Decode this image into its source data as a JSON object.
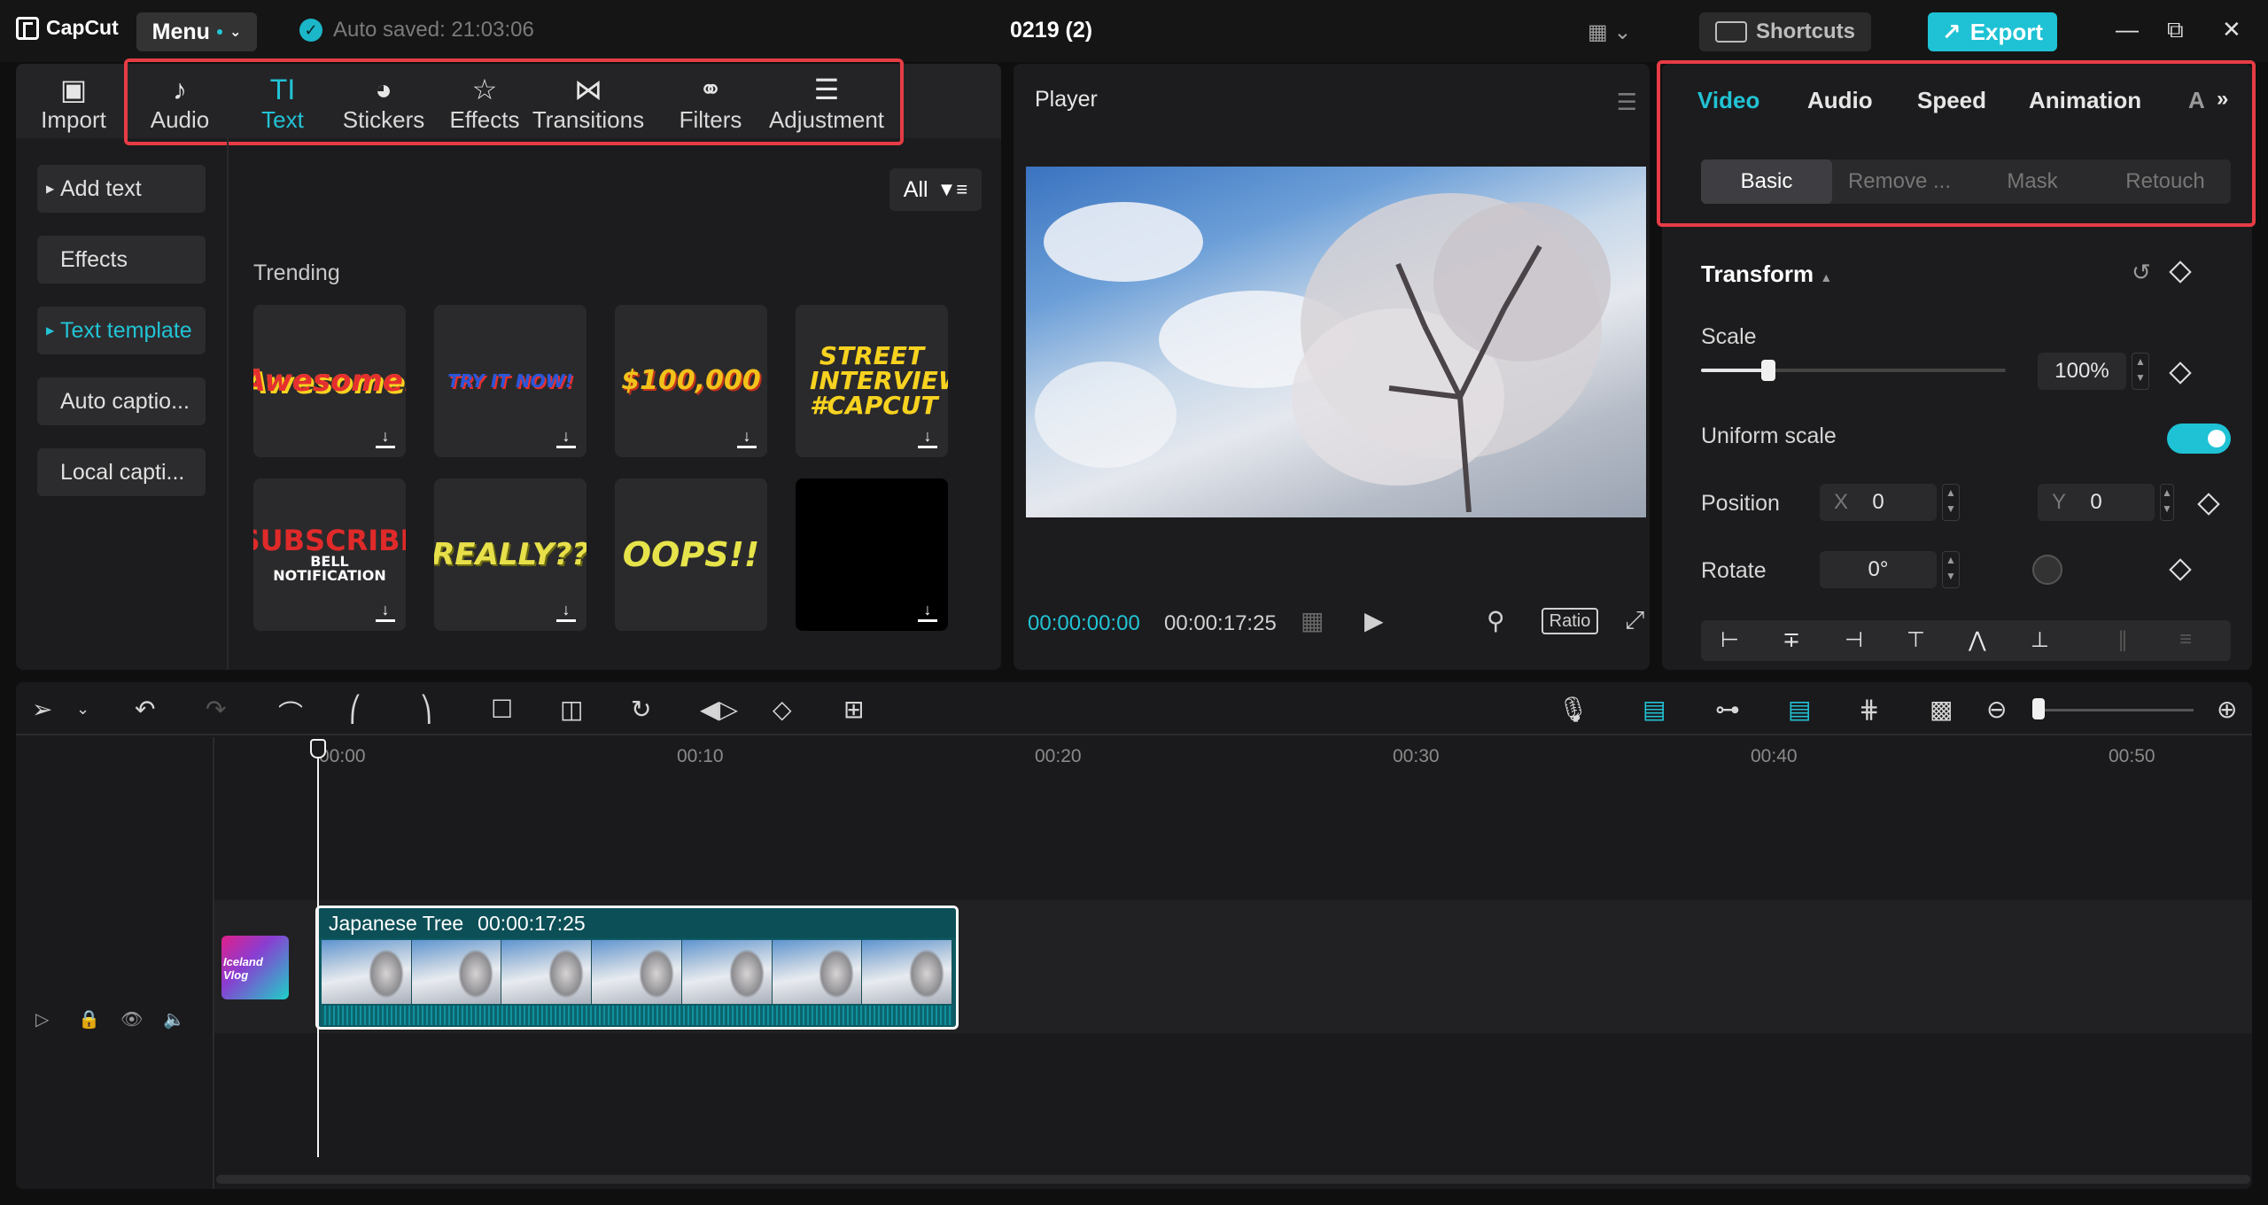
{
  "app": {
    "brand": "CapCut",
    "menu_label": "Menu",
    "autosave": "Auto saved: 21:03:06",
    "project_title": "0219 (2)",
    "shortcuts_label": "Shortcuts",
    "export_label": "Export"
  },
  "media_tools": [
    {
      "label": "Import",
      "icon": "import-icon"
    },
    {
      "label": "Audio",
      "icon": "audio-icon"
    },
    {
      "label": "Text",
      "icon": "text-icon",
      "active": true
    },
    {
      "label": "Stickers",
      "icon": "stickers-icon"
    },
    {
      "label": "Effects",
      "icon": "effects-icon"
    },
    {
      "label": "Transitions",
      "icon": "transitions-icon"
    },
    {
      "label": "Filters",
      "icon": "filters-icon"
    },
    {
      "label": "Adjustment",
      "icon": "adjustment-icon"
    }
  ],
  "text_nav": [
    {
      "label": "Add text"
    },
    {
      "label": "Effects"
    },
    {
      "label": "Text template",
      "active": true
    },
    {
      "label": "Auto captio..."
    },
    {
      "label": "Local capti..."
    }
  ],
  "library": {
    "filter_label": "All",
    "section_title": "Trending",
    "templates": [
      {
        "text": "Awesome!",
        "color": "#e52f2f"
      },
      {
        "text": "TRY IT NOW!",
        "color": "#2a56d8"
      },
      {
        "text": "$100,000",
        "color": "#f2c21a"
      },
      {
        "text": "STREET INTERVIEW #CAPCUT",
        "color": "#f7d21f"
      },
      {
        "text": "SUBSCRIBE",
        "subtext": "BELL NOTIFICATION",
        "color": "#e02a2a"
      },
      {
        "text": "REALLY??",
        "color": "#e8e04a"
      },
      {
        "text": "OOPS!!",
        "color": "#e6e44a"
      },
      {
        "text": "",
        "color": "#000000"
      }
    ]
  },
  "player": {
    "title": "Player",
    "current_time": "00:00:00:00",
    "duration": "00:00:17:25",
    "ratio_label": "Ratio"
  },
  "inspector": {
    "tabs": [
      "Video",
      "Audio",
      "Speed",
      "Animation",
      "A"
    ],
    "active_tab": "Video",
    "subtabs": [
      "Basic",
      "Remove ...",
      "Mask",
      "Retouch"
    ],
    "active_subtab": "Basic",
    "section": "Transform",
    "scale_label": "Scale",
    "scale_value": "100%",
    "scale_fraction": 0.22,
    "uniform_scale_label": "Uniform scale",
    "uniform_scale_on": true,
    "position_label": "Position",
    "x_axis": "X",
    "x_value": "0",
    "y_axis": "Y",
    "y_value": "0",
    "rotate_label": "Rotate",
    "rotate_value": "0°"
  },
  "timeline": {
    "ruler_labels": [
      "00:00",
      "00:10",
      "00:20",
      "00:30",
      "00:40",
      "00:50"
    ],
    "clip_name": "Japanese Tree",
    "clip_duration": "00:00:17:25",
    "cover_label": "Iceland Vlog"
  },
  "colors": {
    "accent": "#22c3d5",
    "highlight": "#e63c45",
    "export": "#1ec2d4"
  }
}
